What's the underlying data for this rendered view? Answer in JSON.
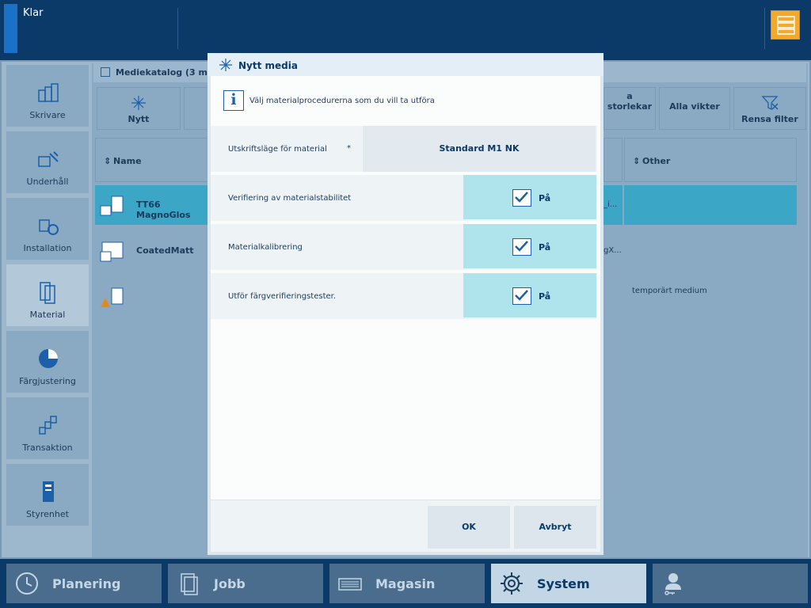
{
  "status": {
    "text": "Klar"
  },
  "nav": {
    "items": [
      {
        "label": "Skrivare",
        "icon": "printer-icon"
      },
      {
        "label": "Underhåll",
        "icon": "maintenance-icon"
      },
      {
        "label": "Installation",
        "icon": "installation-icon"
      },
      {
        "label": "Material",
        "icon": "material-icon",
        "active": true
      },
      {
        "label": "Färgjustering",
        "icon": "color-adjust-icon"
      },
      {
        "label": "Transaktion",
        "icon": "transaction-icon"
      },
      {
        "label": "Styrenhet",
        "icon": "controller-icon"
      }
    ]
  },
  "catalog": {
    "breadcrumb": "Mediekatalog (3 media",
    "toolbar": {
      "new": "Nytt",
      "all_sizes": "a storlekar",
      "all_weights": "Alla vikter",
      "clear_filter": "Rensa filter"
    },
    "columns": {
      "name": "Name",
      "other": "Other"
    },
    "rows": [
      {
        "name": "TT66 MagnoGlos",
        "mid": "_i...",
        "other": ""
      },
      {
        "name": "CoatedMatt",
        "mid": "gX...",
        "other": ""
      },
      {
        "name": "",
        "mid": "",
        "other": "temporärt medium"
      }
    ]
  },
  "dialog": {
    "title": "Nytt media",
    "info": "Välj materialprocedurerna som du vill ta utföra",
    "print_mode": {
      "label": "Utskriftsläge för material",
      "required": "*",
      "value": "Standard M1 NK"
    },
    "procedures": [
      {
        "label": "Verifiering av materialstabilitet",
        "state": "På"
      },
      {
        "label": "Materialkalibrering",
        "state": "På"
      },
      {
        "label": "Utför färgverifieringstester.",
        "state": "På"
      }
    ],
    "ok": "OK",
    "cancel": "Avbryt"
  },
  "tabs": [
    {
      "label": "Planering",
      "icon": "clock-icon"
    },
    {
      "label": "Jobb",
      "icon": "jobs-icon"
    },
    {
      "label": "Magasin",
      "icon": "tray-icon"
    },
    {
      "label": "System",
      "icon": "gear-icon",
      "active": true
    },
    {
      "label": "",
      "icon": "user-key-icon"
    }
  ],
  "colors": {
    "accent": "#1a72c8",
    "highlight": "#f3a92b",
    "toggle": "#b0e4ec"
  }
}
